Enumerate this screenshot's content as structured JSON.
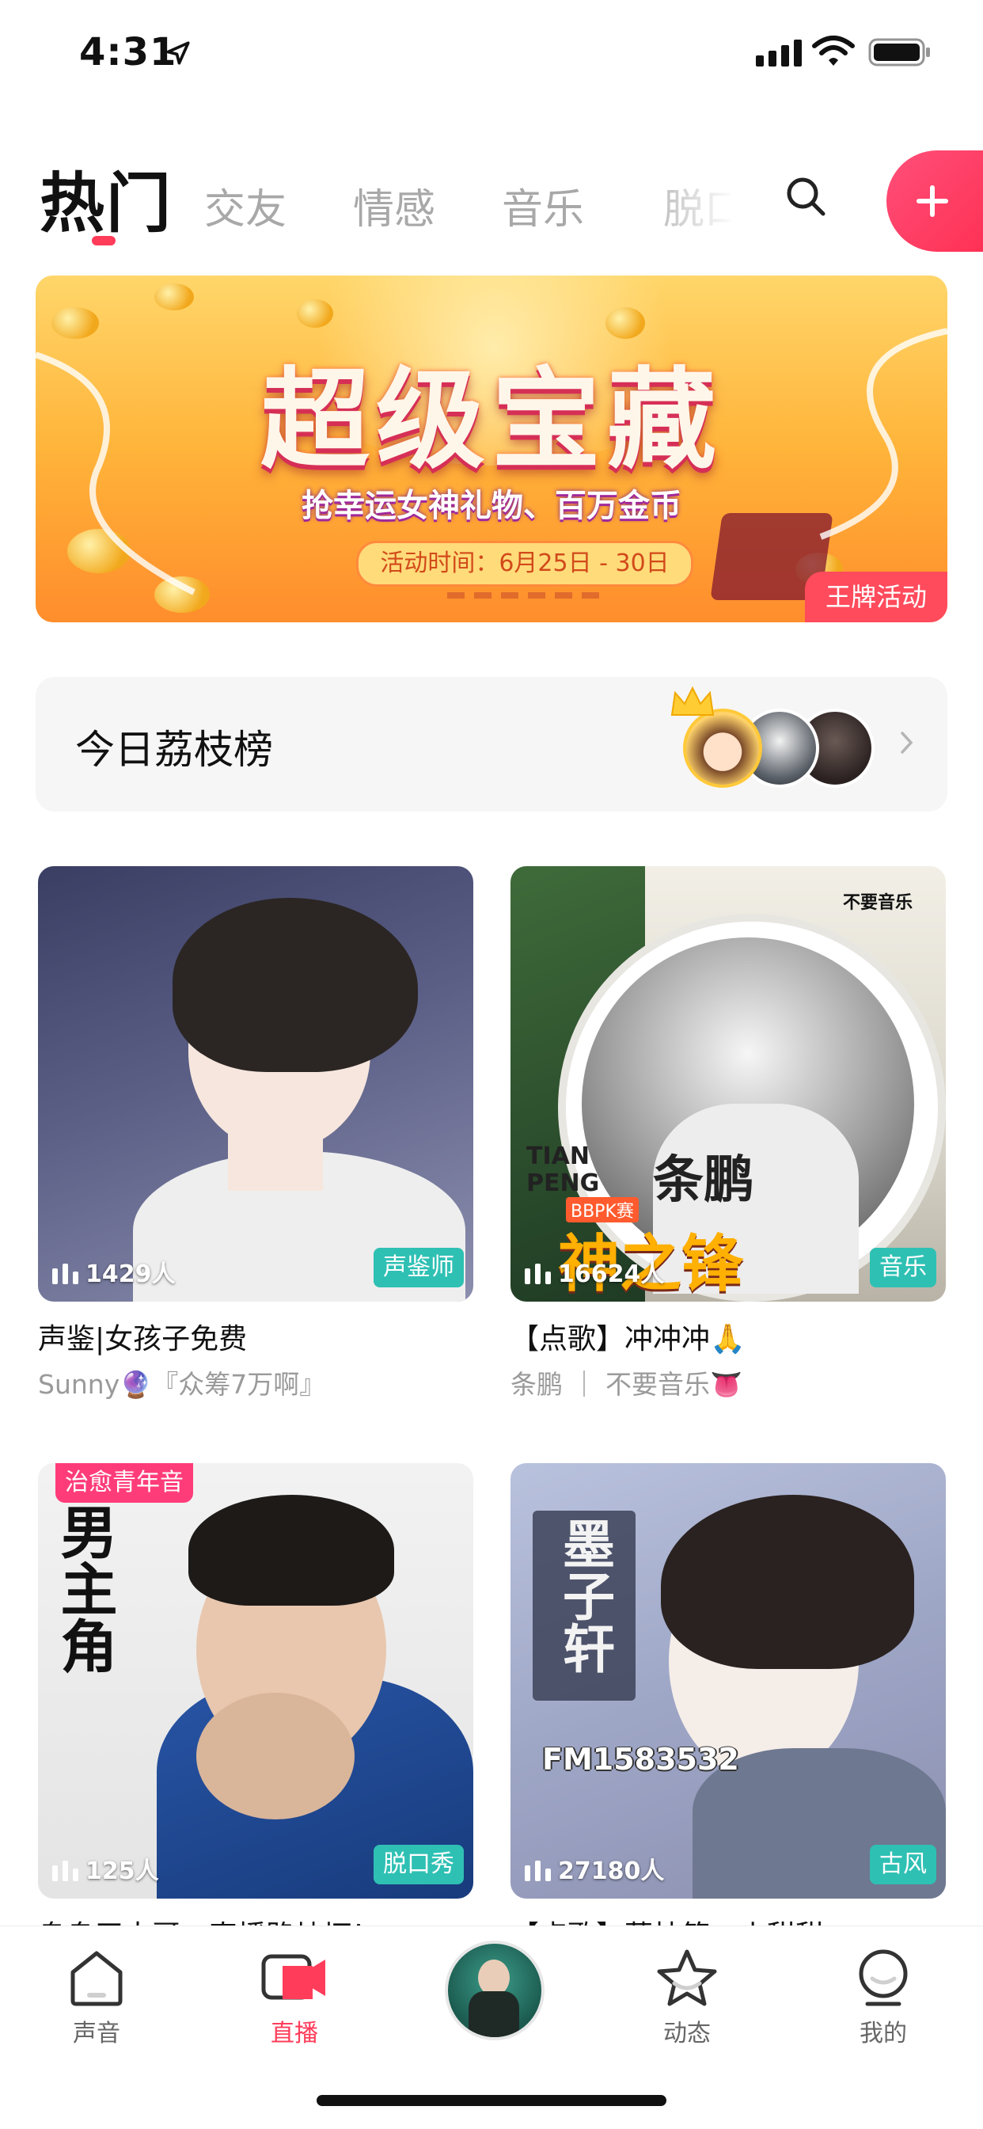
{
  "status_bar": {
    "time": "4:31"
  },
  "tabs": {
    "active": "热门",
    "items": [
      "交友",
      "情感",
      "音乐",
      "脱口秀"
    ]
  },
  "banner": {
    "title": "超级宝藏",
    "subtitle": "抢幸运女神礼物、百万金币",
    "date": "活动时间：6月25日 - 30日",
    "tag": "王牌活动"
  },
  "rank": {
    "title": "今日荔枝榜"
  },
  "cards": [
    {
      "viewers": "1429人",
      "category": "声鉴师",
      "title": "声鉴|女孩子免费",
      "subtitle": "Sunny🔮『众筹7万啊』"
    },
    {
      "viewers": "16624人",
      "category": "音乐",
      "title": "【点歌】冲冲冲🙏",
      "subtitle": "条鹏 ｜ 不要音乐👅",
      "art_text": {
        "name": "条鹏",
        "pinyin": "TIAN PENG",
        "slogan": "神之锋",
        "badge": "BBPK赛",
        "brand": "不要音乐"
      }
    },
    {
      "viewers": "125人",
      "category": "脱口秀",
      "top_tag": "治愈青年音",
      "title": "阜阜王大哥，直播路炒坷！",
      "subtitle": "",
      "art_text": {
        "vertical": "男主角"
      }
    },
    {
      "viewers": "27180人",
      "category": "古风",
      "title": "【点歌】荔枝第一小甜甜",
      "subtitle": "",
      "art_text": {
        "vertical": "墨子轩",
        "fm": "FM1583532"
      }
    }
  ],
  "nav": [
    {
      "label": "声音",
      "icon": "home-icon"
    },
    {
      "label": "直播",
      "icon": "camera-icon",
      "active": true
    },
    {
      "label": "",
      "icon": "avatar"
    },
    {
      "label": "动态",
      "icon": "star-icon"
    },
    {
      "label": "我的",
      "icon": "profile-icon"
    }
  ],
  "colors": {
    "accent": "#ff3c5a",
    "category_tag": "#2fc0b4",
    "rank_bg": "#f6f6f6"
  }
}
